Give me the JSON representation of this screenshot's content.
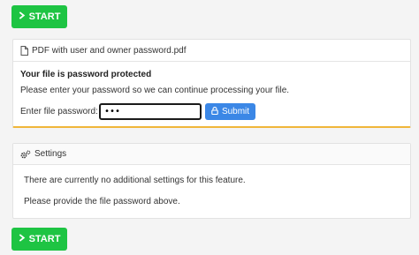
{
  "start_button_label": "START",
  "file_panel": {
    "file_name": "PDF with user and owner password.pdf",
    "heading": "Your file is password protected",
    "message": "Please enter your password so we can continue processing your file.",
    "password_label": "Enter file password:",
    "password_value": "•••",
    "submit_label": "Submit"
  },
  "settings_panel": {
    "title": "Settings",
    "line1": "There are currently no additional settings for this feature.",
    "line2": "Please provide the file password above."
  },
  "colors": {
    "start": "#1ec443",
    "submit": "#3b87e6",
    "warning_border": "#f0b63a"
  }
}
